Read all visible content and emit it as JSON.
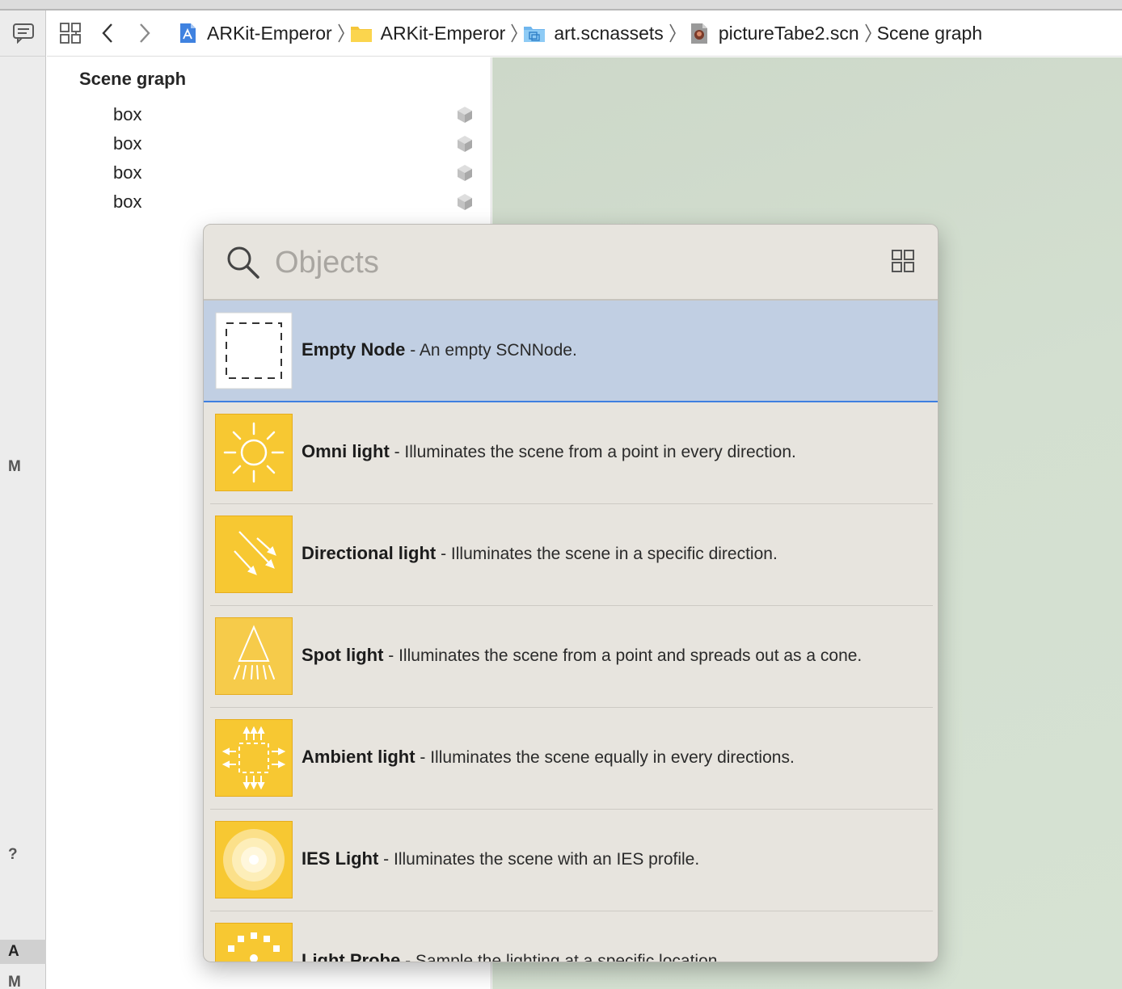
{
  "gutter": {
    "letters": [
      "M",
      "?",
      "A",
      "M"
    ]
  },
  "breadcrumb": [
    {
      "label": "ARKit-Emperor",
      "icon": "project-icon"
    },
    {
      "label": "ARKit-Emperor",
      "icon": "folder-icon"
    },
    {
      "label": "art.scnassets",
      "icon": "scnassets-folder-icon"
    },
    {
      "label": "pictureTabe2.scn",
      "icon": "scene-file-icon"
    },
    {
      "label": "Scene graph"
    }
  ],
  "scene_graph": {
    "title": "Scene graph",
    "nodes": [
      "box",
      "box",
      "box",
      "box"
    ]
  },
  "library": {
    "search_placeholder": "Objects",
    "items": [
      {
        "name": "Empty Node",
        "description": "- An empty SCNNode.",
        "icon": "empty-node-icon",
        "selected": true
      },
      {
        "name": "Omni light",
        "description": "- Illuminates the scene from a point in every direction.",
        "icon": "omni-light-icon"
      },
      {
        "name": "Directional light",
        "description": "- Illuminates the scene in a specific direction.",
        "icon": "directional-light-icon"
      },
      {
        "name": "Spot light",
        "description": "- Illuminates the scene from a point and spreads out as a cone.",
        "icon": "spot-light-icon"
      },
      {
        "name": "Ambient light",
        "description": "- Illuminates the scene equally in every directions.",
        "icon": "ambient-light-icon"
      },
      {
        "name": "IES Light",
        "description": "- Illuminates the scene with an IES profile.",
        "icon": "ies-light-icon"
      },
      {
        "name": "Light Probe",
        "description": "- Sample the lighting at a specific location.",
        "icon": "light-probe-icon"
      }
    ]
  },
  "colors": {
    "selection": "#c1cfe3",
    "selection_border": "#3e7fe0",
    "light_tile": "#f7c832",
    "viewport": "#d3dfd0"
  }
}
